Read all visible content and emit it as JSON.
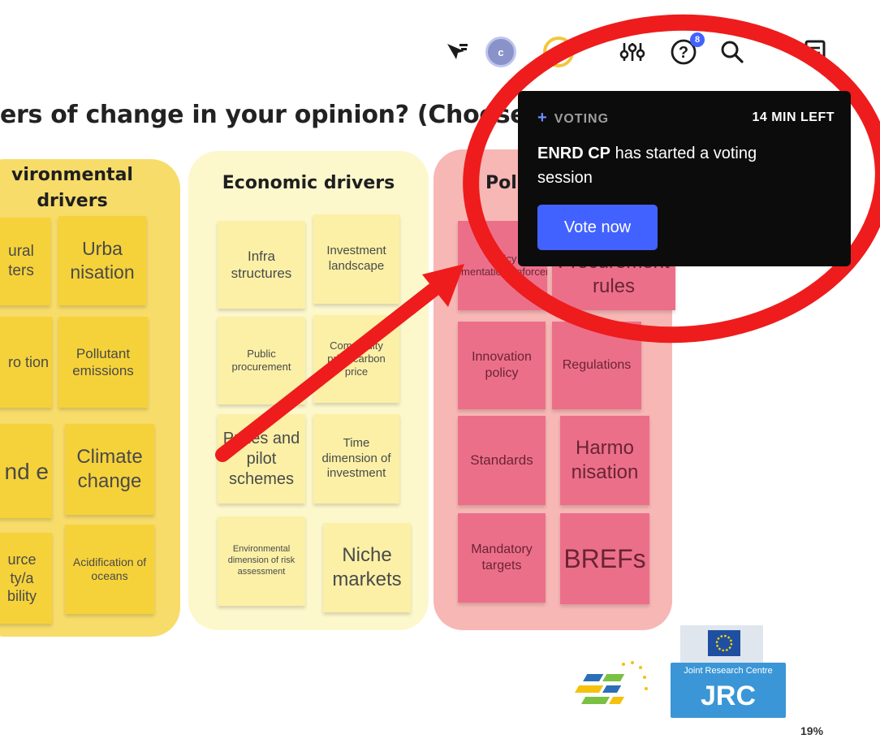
{
  "toolbar": {
    "icons": [
      "cursor-filter-icon",
      "avatar",
      "avatar-ring",
      "sliders-icon",
      "help-icon",
      "search-icon",
      "notes-icon"
    ],
    "avatar_initial": "c",
    "help_badge_count": "8"
  },
  "question": "ers of change in your opinion? (Choose 3",
  "columns": {
    "environmental": {
      "title": "vironmental drivers",
      "color": "#f7dc6a",
      "notes": [
        "ural ters",
        "Urba nisation",
        "ro tion",
        "Pollutant emissions",
        "nd e",
        "Climate change",
        "urce ty/a bility",
        "Acidification of oceans"
      ]
    },
    "economic": {
      "title": "Economic drivers",
      "color": "#fdf7cc",
      "notes": [
        "Infra structures",
        "Investment landscape",
        "Public procurement",
        "Commodity price/carbon price",
        "Prizes and pilot schemes",
        "Time dimension of investment",
        "Environmental dimension of risk assessment",
        "Niche markets"
      ]
    },
    "policy": {
      "title": "Pol",
      "color": "#f7b7b5",
      "notes": [
        "Policy implementation/enforcement",
        "Procurement rules",
        "Innovation policy",
        "Regulations",
        "Standards",
        "Harmo nisation",
        "Mandatory targets",
        "BREFs"
      ]
    }
  },
  "notification": {
    "label": "VOTING",
    "time_left": "14 MIN LEFT",
    "user": "ENRD CP",
    "message": " has started a voting session",
    "button": "Vote now",
    "accent": "#4262ff"
  },
  "logos": {
    "jrc_caption": "Joint Research Centre",
    "jrc_text": "JRC"
  },
  "zoom_level": "19%"
}
